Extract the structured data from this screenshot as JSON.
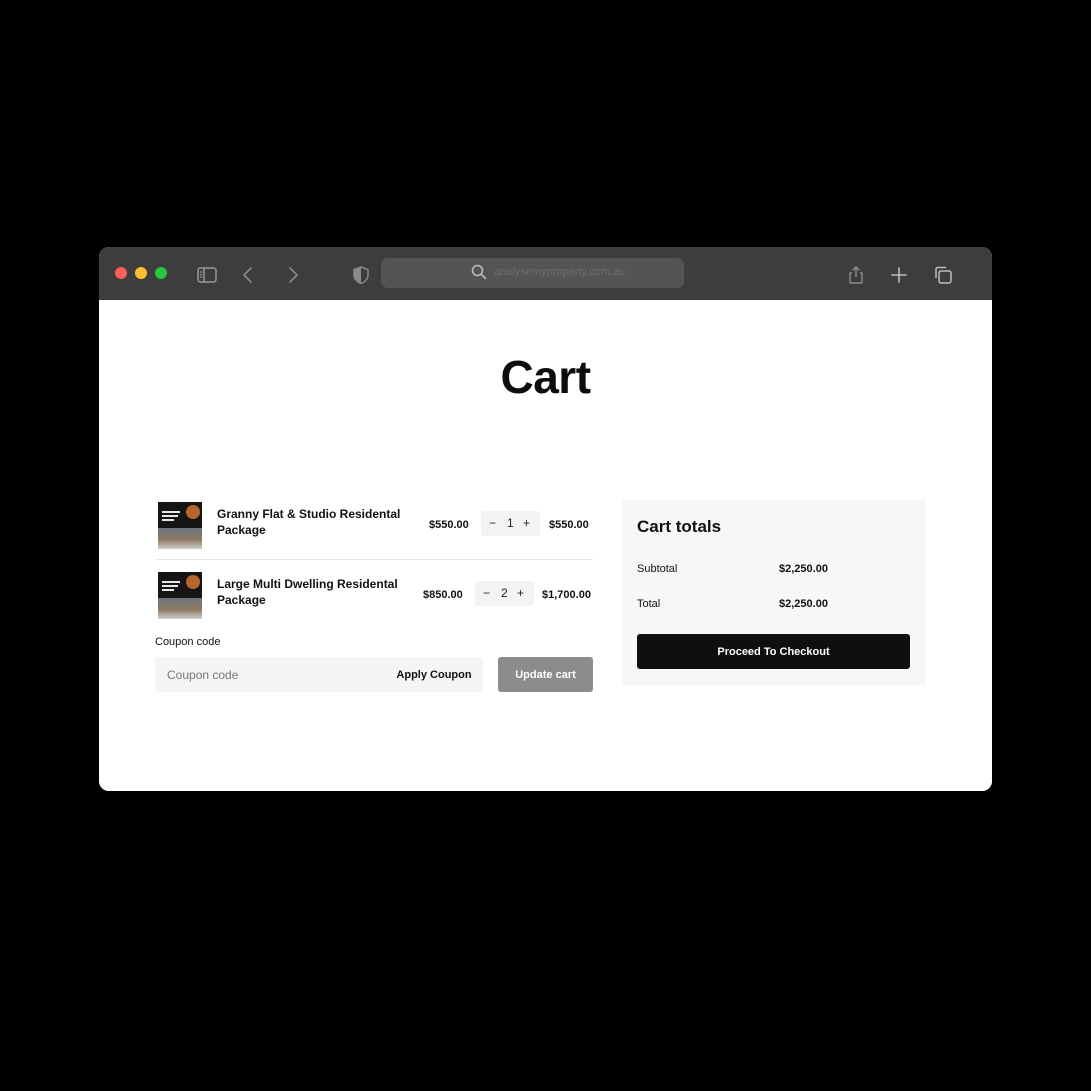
{
  "browser": {
    "url": "analysemyproperty.com.au",
    "icons": [
      "sidebar-icon",
      "back-icon",
      "forward-icon",
      "shield-icon",
      "search-icon",
      "share-icon",
      "new-tab-icon",
      "tabs-icon"
    ]
  },
  "page": {
    "title": "Cart"
  },
  "cart": {
    "items": [
      {
        "name": "Granny Flat & Studio Residental Package",
        "price": "$550.00",
        "quantity": "1",
        "subtotal": "$550.00"
      },
      {
        "name": "Large Multi Dwelling Residental Package",
        "price": "$850.00",
        "quantity": "2",
        "subtotal": "$1,700.00"
      }
    ],
    "qty_minus": "−",
    "qty_plus": "+"
  },
  "coupon": {
    "label": "Coupon code",
    "placeholder": "Coupon code",
    "apply_label": "Apply Coupon",
    "update_label": "Update cart"
  },
  "totals": {
    "title": "Cart totals",
    "subtotal_label": "Subtotal",
    "subtotal_value": "$2,250.00",
    "total_label": "Total",
    "total_value": "$2,250.00",
    "checkout_label": "Proceed To Checkout"
  },
  "colors": {
    "toolbar": "#3d3d3d",
    "checkout_button": "#0f0f0f",
    "update_button": "#8c8c8c",
    "totals_panel": "#f7f7f7"
  }
}
